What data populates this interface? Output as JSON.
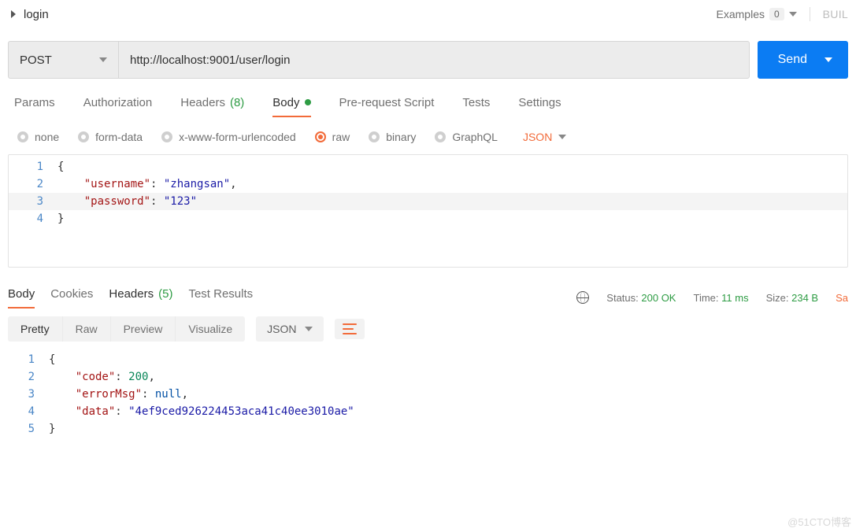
{
  "header": {
    "tab_name": "login",
    "examples_label": "Examples",
    "examples_count": "0",
    "build_label": "BUIL"
  },
  "request": {
    "method": "POST",
    "url": "http://localhost:9001/user/login",
    "send_label": "Send"
  },
  "req_tabs": {
    "params": "Params",
    "authorization": "Authorization",
    "headers": "Headers",
    "headers_count": "(8)",
    "body": "Body",
    "pre_request": "Pre-request Script",
    "tests": "Tests",
    "settings": "Settings"
  },
  "body_modes": {
    "none": "none",
    "form_data": "form-data",
    "xwww": "x-www-form-urlencoded",
    "raw": "raw",
    "binary": "binary",
    "graphql": "GraphQL",
    "json": "JSON"
  },
  "req_body": {
    "l1": "{",
    "l2_key": "\"username\"",
    "l2_val": "\"zhangsan\"",
    "l3_key": "\"password\"",
    "l3_val": "\"123\"",
    "l4": "}"
  },
  "resp_tabs": {
    "body": "Body",
    "cookies": "Cookies",
    "headers": "Headers",
    "headers_count": "(5)",
    "test_results": "Test Results"
  },
  "resp_meta": {
    "status_label": "Status:",
    "status_value": "200 OK",
    "time_label": "Time:",
    "time_value": "11 ms",
    "size_label": "Size:",
    "size_value": "234 B",
    "save": "Sa"
  },
  "resp_toolbar": {
    "pretty": "Pretty",
    "raw": "Raw",
    "preview": "Preview",
    "visualize": "Visualize",
    "json": "JSON"
  },
  "resp_body": {
    "l1": "{",
    "l2_key": "\"code\"",
    "l2_val": "200",
    "l3_key": "\"errorMsg\"",
    "l3_val": "null",
    "l4_key": "\"data\"",
    "l4_val": "\"4ef9ced926224453aca41c40ee3010ae\"",
    "l5": "}"
  },
  "watermark": "@51CTO博客"
}
